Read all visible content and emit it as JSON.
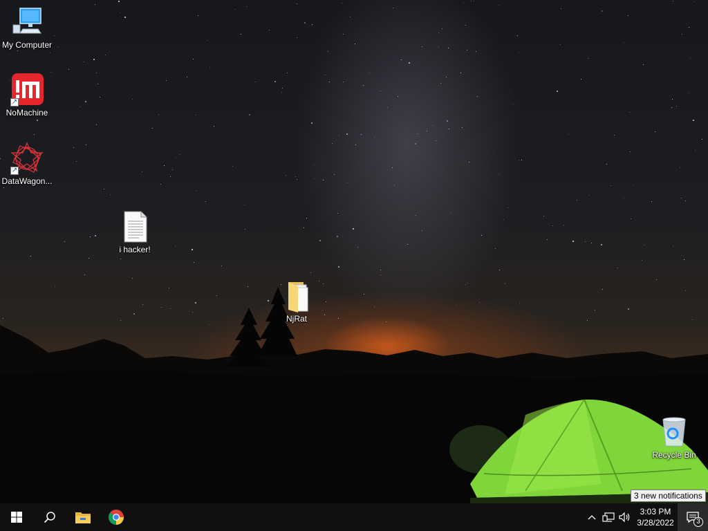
{
  "desktop": {
    "icons": [
      {
        "label": "My Computer",
        "icon": "computer-icon"
      },
      {
        "label": "NoMachine",
        "icon": "nomachine-icon"
      },
      {
        "label": "DataWagon...",
        "icon": "datawagon-icon"
      },
      {
        "label": "i hacker!",
        "icon": "text-document-icon"
      },
      {
        "label": "NjRat",
        "icon": "folder-icon"
      },
      {
        "label": "Recycle Bin",
        "icon": "recycle-bin-icon"
      }
    ]
  },
  "taskbar": {
    "pinned": [
      {
        "name": "start",
        "icon": "windows-logo-icon"
      },
      {
        "name": "search",
        "icon": "search-icon"
      },
      {
        "name": "file-explorer",
        "icon": "folder-icon"
      },
      {
        "name": "chrome",
        "icon": "chrome-icon"
      }
    ],
    "tray": {
      "time": "3:03 PM",
      "date": "3/28/2022",
      "notification_count": "3",
      "tooltip": "3 new notifications"
    }
  },
  "colors": {
    "taskbar": "#101010",
    "nomachine_red": "#e5262d",
    "tent_green": "#8fe23a"
  }
}
